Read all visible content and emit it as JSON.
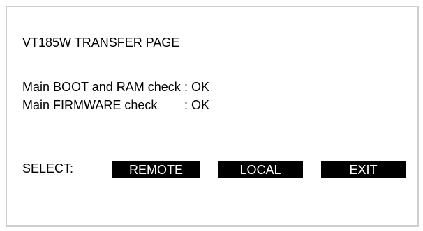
{
  "screen": {
    "title": "VT185W TRANSFER PAGE",
    "checks": [
      {
        "label": "Main BOOT and RAM check",
        "value": ": OK"
      },
      {
        "label": "Main FIRMWARE check",
        "value": ": OK"
      }
    ],
    "select_label": "SELECT:",
    "buttons": {
      "remote": "REMOTE",
      "local": "LOCAL",
      "exit": "EXIT"
    }
  },
  "colors": {
    "background": "#ffffff",
    "border": "#cfcfcf",
    "button_bg": "#000000",
    "button_text": "#ffffff",
    "text": "#000000"
  }
}
